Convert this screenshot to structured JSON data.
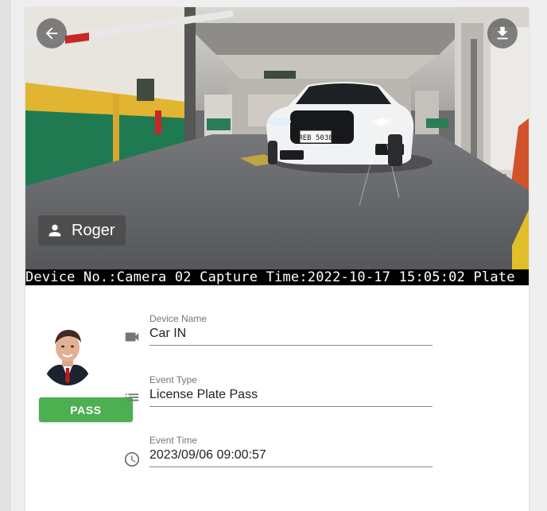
{
  "snapshot": {
    "person_name": "Roger",
    "osd_text": "Device No.:Camera 02 Capture Time:2022-10-17 15:05:02 Plate",
    "plate_text": "REB 5038",
    "icons": {
      "back": "arrow-back-icon",
      "download": "download-icon",
      "person": "person-icon"
    }
  },
  "details": {
    "status_badge": "PASS",
    "status_color": "#4caf50",
    "fields": [
      {
        "label": "Device Name",
        "value": "Car IN",
        "icon": "videocam-icon"
      },
      {
        "label": "Event Type",
        "value": "License Plate Pass",
        "icon": "list-icon"
      },
      {
        "label": "Event Time",
        "value": "2023/09/06 09:00:57",
        "icon": "clock-icon"
      }
    ]
  }
}
